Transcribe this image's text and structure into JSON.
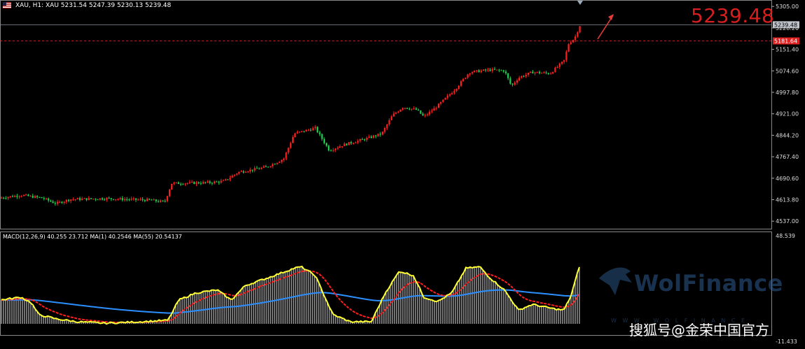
{
  "symbol_header": {
    "text": "XAU, H1:  XAU  5231.54 5247.39 5230.13 5239.48"
  },
  "current_price": {
    "display": "5239.48",
    "axis_tag": "5239.48",
    "color": "#d81e1e"
  },
  "level_line": {
    "axis_tag": "5181.64",
    "color": "#ff2a2a"
  },
  "price_axis": {
    "ticks": [
      "5305.00",
      "5228.20",
      "5151.40",
      "5074.60",
      "4997.80",
      "4921.00",
      "4844.20",
      "4767.40",
      "4690.60",
      "4613.80",
      "4537.00"
    ],
    "min": 4510,
    "max": 5323
  },
  "macd_panel": {
    "header": "MACD(12,26,9) 40.255 23.712 MA(1) 40.2546 MA(55) 20.54137",
    "axis_top": "48.539",
    "axis_bottom": "-11.433",
    "colors": {
      "histogram": "#cccccc",
      "macd_line": "#ffff33",
      "signal_line": "#ff1e1e",
      "ma55_line": "#2c8fff"
    }
  },
  "candle_colors": {
    "up": "#ff1e1e",
    "down": "#1fcf4f"
  },
  "watermark": {
    "brand": "WolFinance",
    "sub": "W W W . W O L F I N A N C E"
  },
  "source_label": "搜狐号@金荣中国官方",
  "chart_data": {
    "type": "candlestick",
    "title": "XAU, H1",
    "price_keypoints": [
      [
        0,
        4620
      ],
      [
        30,
        4630
      ],
      [
        60,
        4620
      ],
      [
        80,
        4600
      ],
      [
        100,
        4615
      ],
      [
        150,
        4618
      ],
      [
        215,
        4612
      ],
      [
        235,
        4605
      ],
      [
        245,
        4672
      ],
      [
        300,
        4675
      ],
      [
        320,
        4680
      ],
      [
        340,
        4712
      ],
      [
        380,
        4730
      ],
      [
        405,
        4760
      ],
      [
        420,
        4850
      ],
      [
        450,
        4870
      ],
      [
        470,
        4790
      ],
      [
        490,
        4810
      ],
      [
        520,
        4830
      ],
      [
        545,
        4850
      ],
      [
        560,
        4915
      ],
      [
        575,
        4945
      ],
      [
        595,
        4935
      ],
      [
        605,
        4910
      ],
      [
        625,
        4950
      ],
      [
        650,
        5010
      ],
      [
        670,
        5070
      ],
      [
        700,
        5078
      ],
      [
        720,
        5075
      ],
      [
        730,
        5020
      ],
      [
        740,
        5050
      ],
      [
        760,
        5070
      ],
      [
        785,
        5065
      ],
      [
        805,
        5110
      ],
      [
        812,
        5175
      ],
      [
        820,
        5190
      ],
      [
        828,
        5239
      ]
    ],
    "macd_keypoints": [
      [
        0,
        5
      ],
      [
        30,
        7
      ],
      [
        45,
        3
      ],
      [
        55,
        -5
      ],
      [
        80,
        -8
      ],
      [
        110,
        -10
      ],
      [
        150,
        -11
      ],
      [
        200,
        -10
      ],
      [
        240,
        -9
      ],
      [
        255,
        5
      ],
      [
        280,
        10
      ],
      [
        310,
        12
      ],
      [
        330,
        5
      ],
      [
        350,
        15
      ],
      [
        380,
        20
      ],
      [
        420,
        27
      ],
      [
        430,
        28
      ],
      [
        450,
        22
      ],
      [
        475,
        -5
      ],
      [
        500,
        -10
      ],
      [
        530,
        -10
      ],
      [
        550,
        10
      ],
      [
        570,
        25
      ],
      [
        590,
        22
      ],
      [
        605,
        7
      ],
      [
        625,
        4
      ],
      [
        645,
        10
      ],
      [
        665,
        27
      ],
      [
        685,
        28
      ],
      [
        700,
        20
      ],
      [
        720,
        12
      ],
      [
        740,
        -2
      ],
      [
        760,
        2
      ],
      [
        790,
        -1
      ],
      [
        805,
        -2
      ],
      [
        815,
        8
      ],
      [
        828,
        30
      ]
    ]
  }
}
